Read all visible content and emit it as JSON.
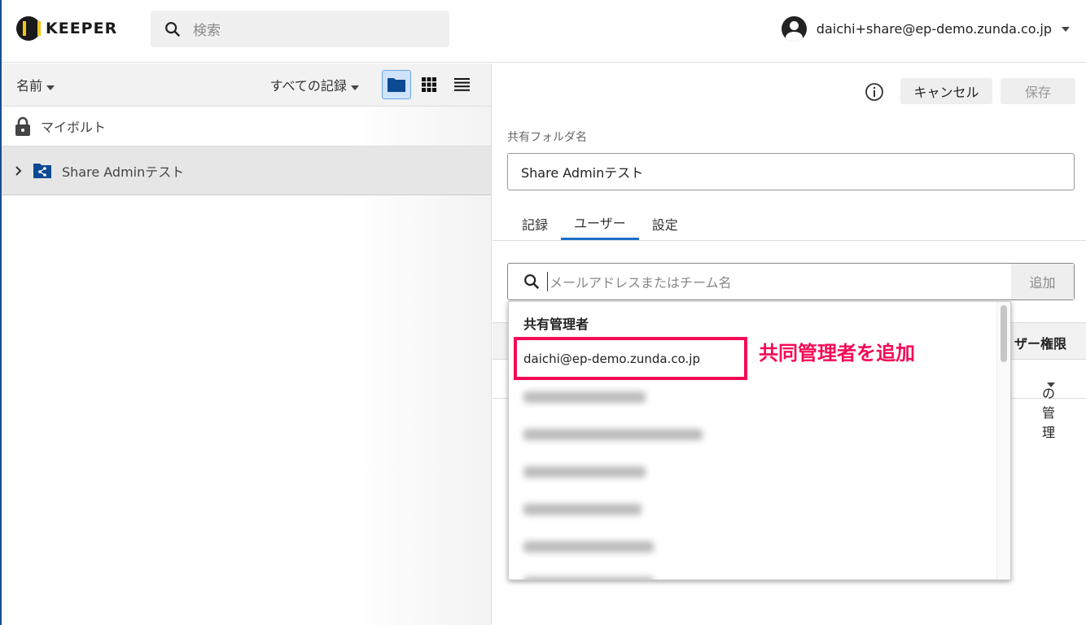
{
  "header": {
    "brand": "KEEPER",
    "search_placeholder": "検索",
    "user_email": "daichi+share@ep-demo.zunda.co.jp"
  },
  "left": {
    "sort_label": "名前",
    "filter_label": "すべての記録",
    "my_vault": "マイボルト",
    "folders": [
      {
        "name": "Share Adminテスト"
      }
    ]
  },
  "right": {
    "cancel": "キャンセル",
    "save": "保存",
    "folder_name_label": "共有フォルダ名",
    "folder_name_value": "Share Adminテスト",
    "tabs": [
      "記録",
      "ユーザー",
      "設定"
    ],
    "user_search_placeholder": "メールアドレスまたはチーム名",
    "add": "追加",
    "table_header": "ザー権限",
    "row_permission": "の管理"
  },
  "dropdown": {
    "title": "共有管理者",
    "items": [
      "daichi@ep-demo.zunda.co.jp"
    ]
  },
  "annotation": {
    "text": "共同管理者を追加",
    "color": "#f50b55"
  }
}
